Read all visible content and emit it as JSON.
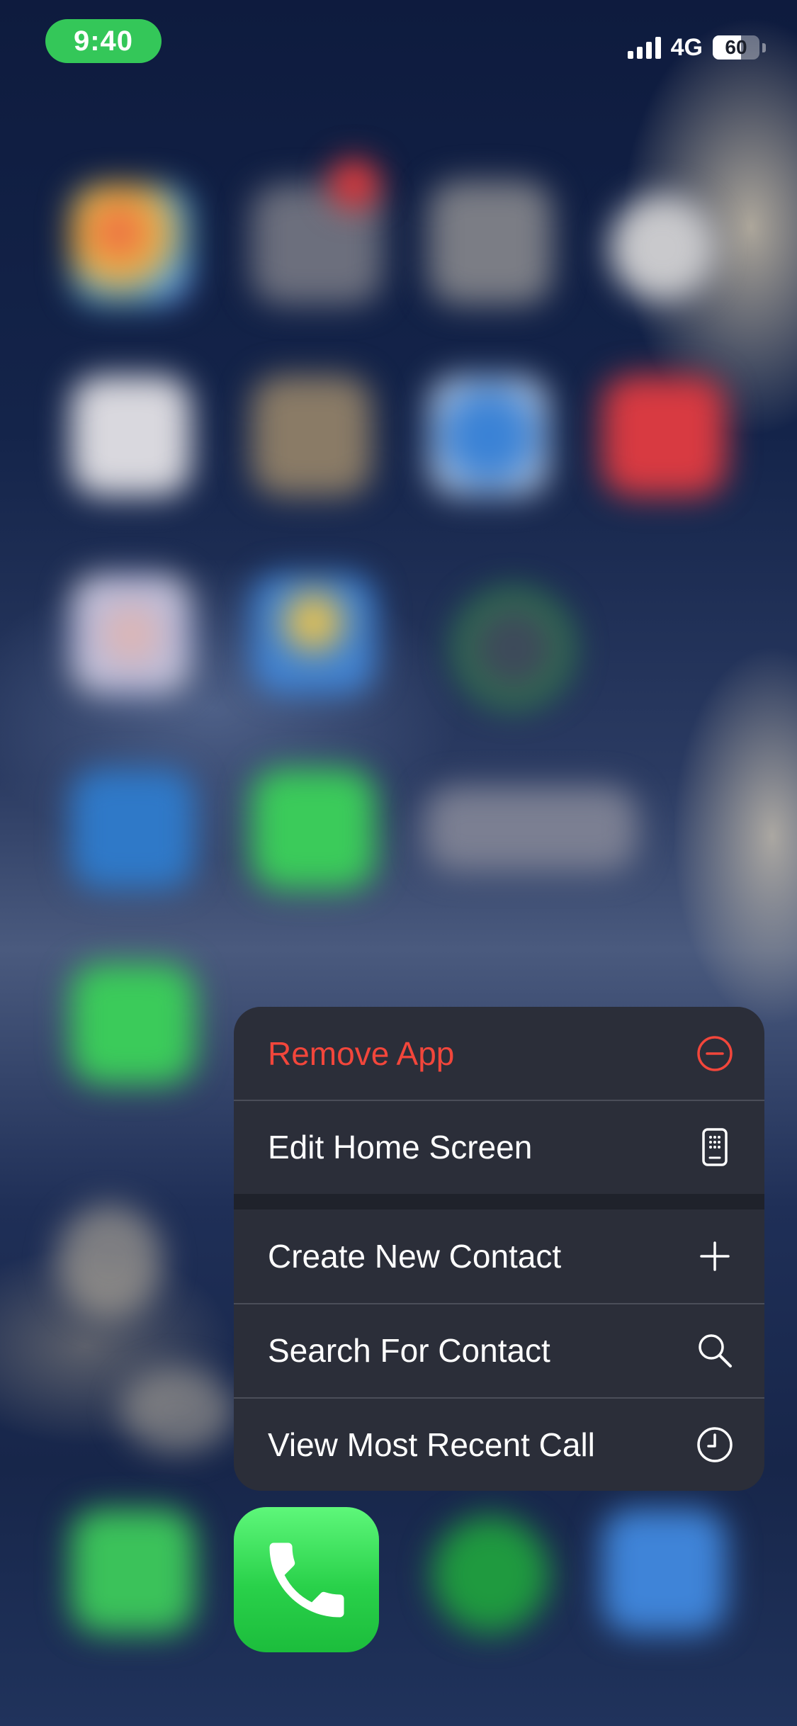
{
  "status_bar": {
    "time": "9:40",
    "network": "4G",
    "battery_level": "60",
    "battery_fraction": 0.6,
    "accent_color": "#34c759"
  },
  "context_menu": {
    "items": [
      {
        "label": "Remove App",
        "icon": "minus-circle-icon",
        "destructive": true
      },
      {
        "label": "Edit Home Screen",
        "icon": "phone-screen-icon",
        "destructive": false
      },
      {
        "label": "Create New Contact",
        "icon": "plus-icon",
        "destructive": false
      },
      {
        "label": "Search For Contact",
        "icon": "search-icon",
        "destructive": false
      },
      {
        "label": "View Most Recent Call",
        "icon": "clock-icon",
        "destructive": false
      }
    ],
    "destructive_color": "#f2463b"
  },
  "app": {
    "icon": "phone-handset-icon",
    "color": "#29d14a"
  }
}
